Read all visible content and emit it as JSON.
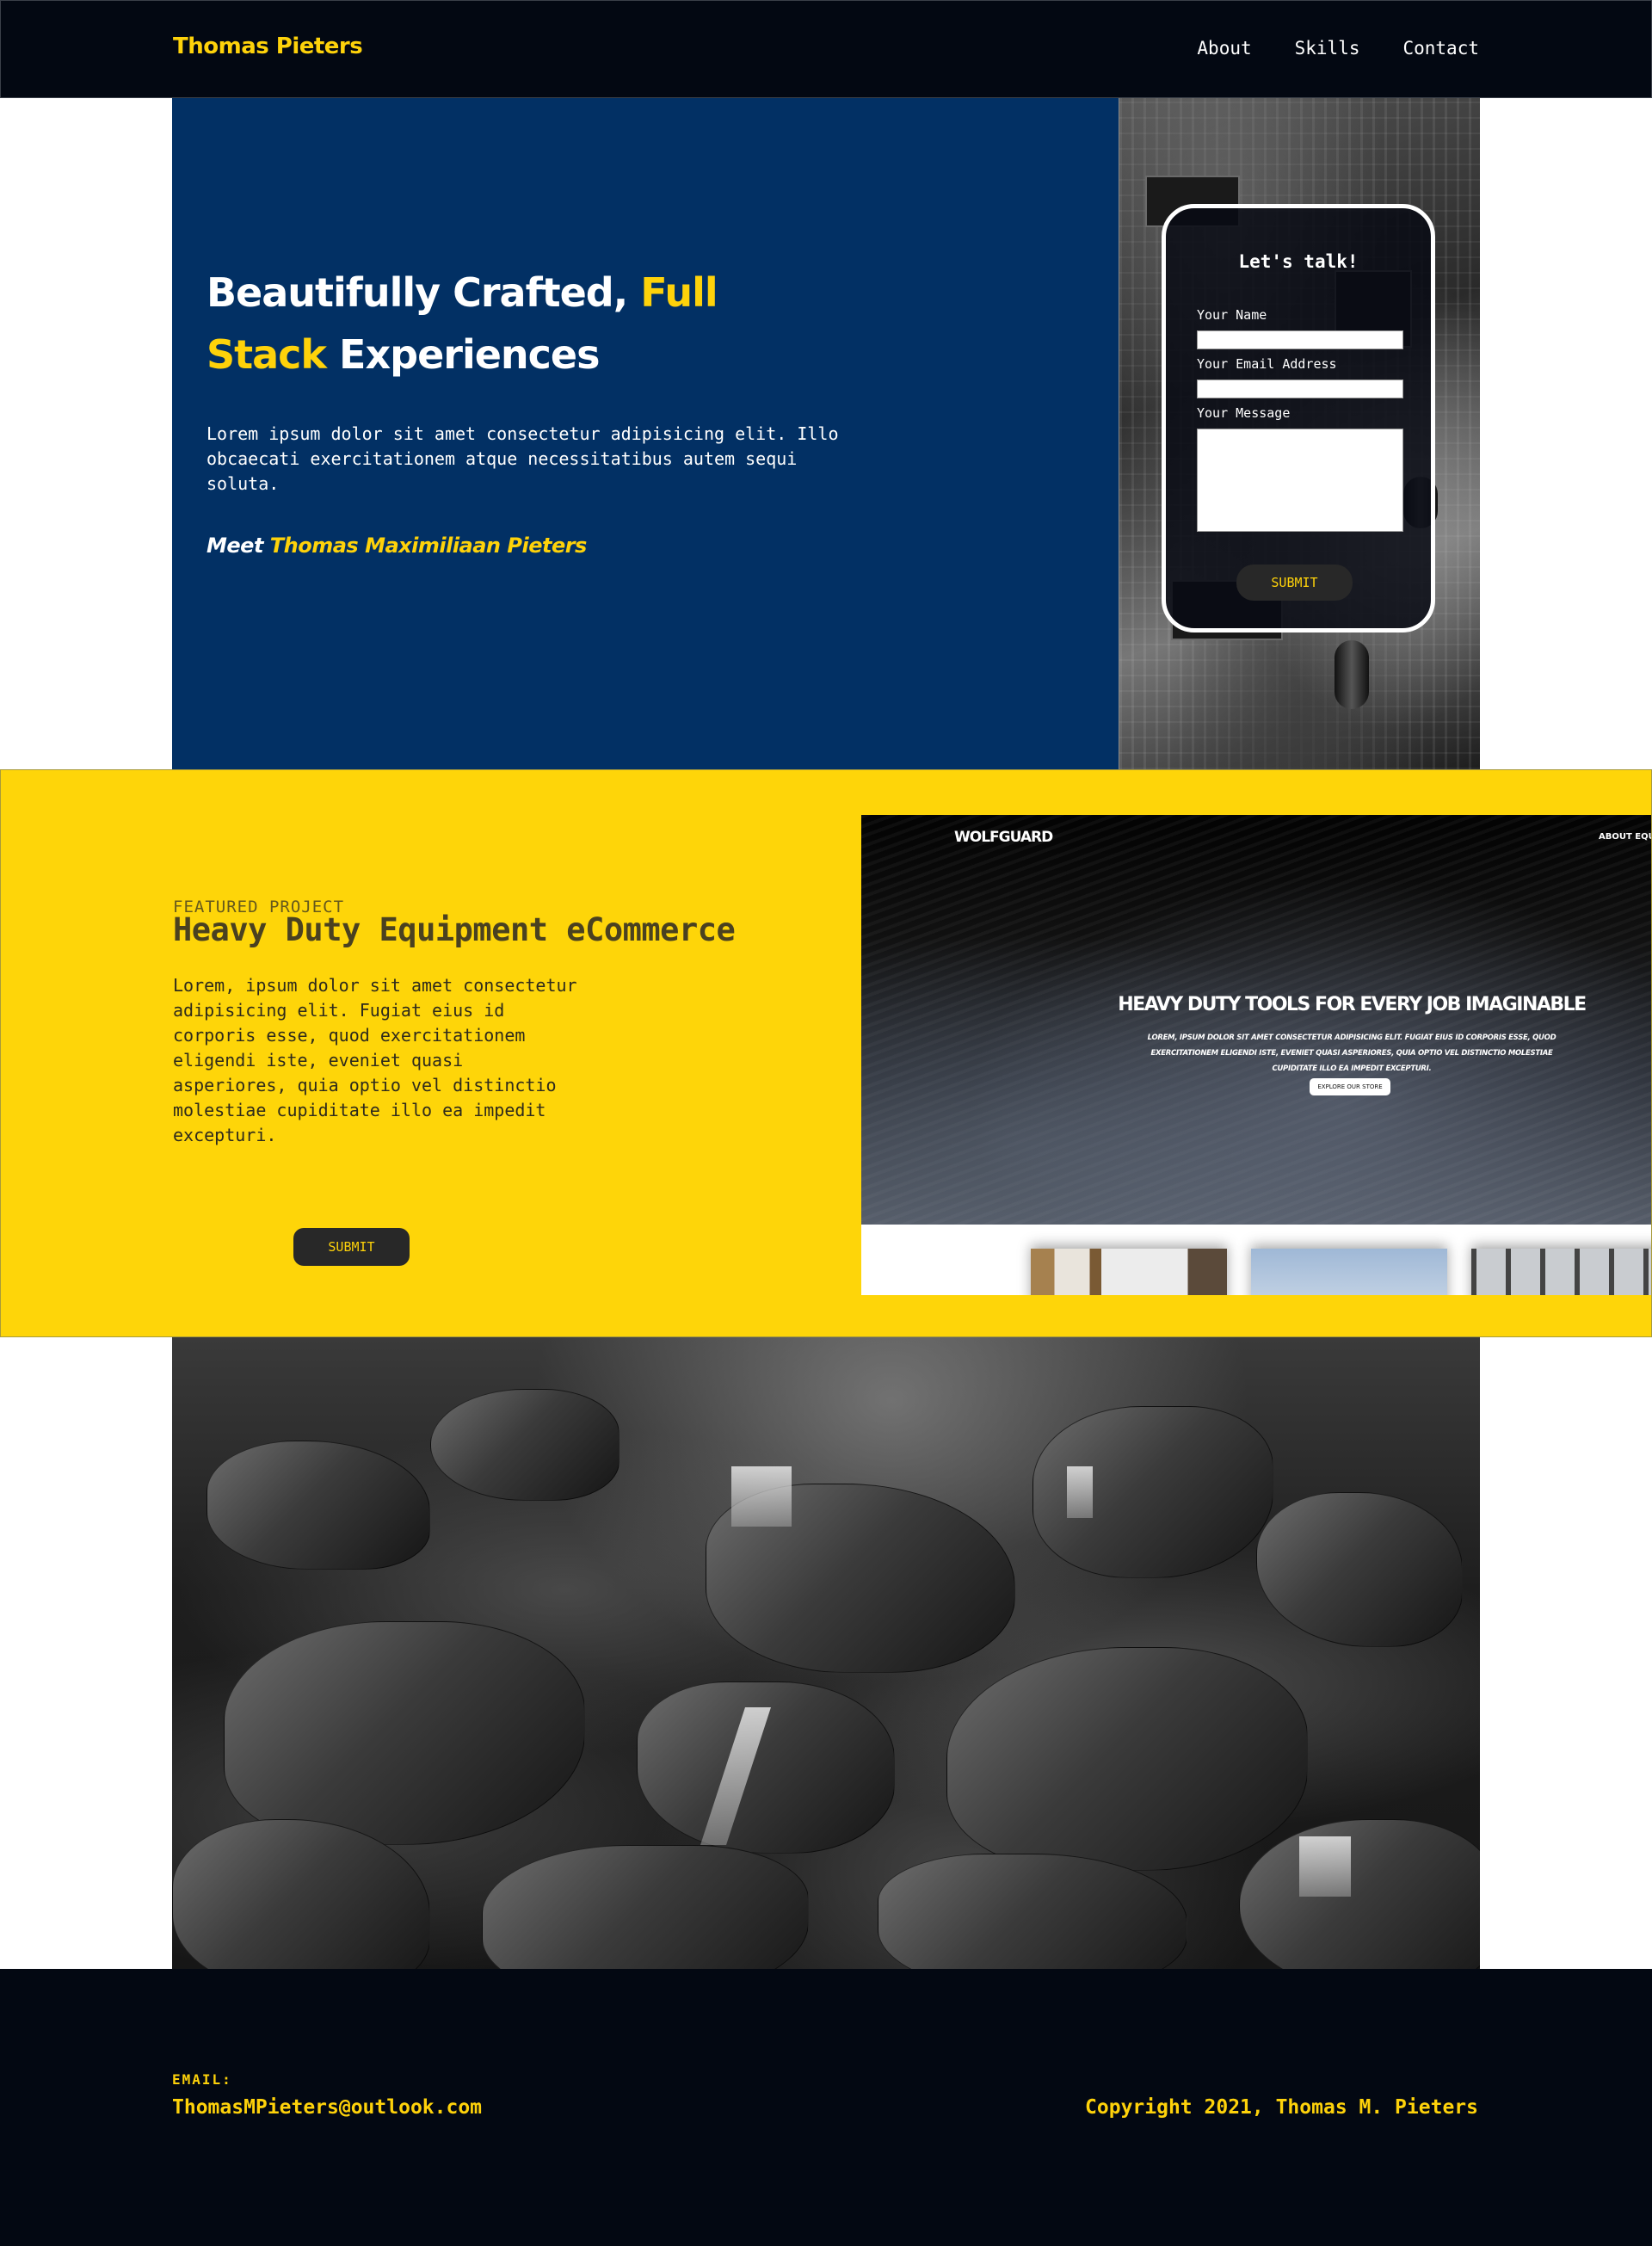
{
  "nav": {
    "brand": "Thomas Pieters",
    "links": [
      "About",
      "Skills",
      "Contact"
    ]
  },
  "hero": {
    "title_part1": "Beautifully Crafted,",
    "title_highlight1": "Full",
    "title_highlight2": "Stack",
    "title_part2": "Experiences",
    "text": "Lorem ipsum dolor sit amet consectetur adipisicing elit. Illo obcaecati exercitationem atque necessitatibus autem sequi soluta.",
    "meet_prefix": "Meet",
    "meet_name": "Thomas Maximiliaan Pieters"
  },
  "contact": {
    "title": "Let's talk!",
    "name_label": "Your Name",
    "name_value": "",
    "email_label": "Your Email Address",
    "email_value": "",
    "message_label": "Your Message",
    "message_value": "",
    "submit": "SUBMIT"
  },
  "featured": {
    "kicker": "FEATURED PROJECT",
    "title": "Heavy Duty Equipment eCommerce",
    "text": "Lorem, ipsum dolor sit amet consectetur adipisicing elit. Fugiat eius id corporis esse, quod exercitationem eligendi iste, eveniet quasi asperiores, quia optio vel distinctio molestiae cupiditate illo ea impedit excepturi.",
    "button": "SUBMIT",
    "preview": {
      "logo": "WOLFGUARD",
      "nav": "ABOUT   EQUIP",
      "headline": "HEAVY DUTY TOOLS FOR EVERY JOB IMAGINABLE",
      "sub": "LOREM, IPSUM DOLOR SIT AMET CONSECTETUR ADIPISICING ELIT. FUGIAT EIUS ID CORPORIS ESSE, QUOD EXERCITATIONEM ELIGENDI ISTE, EVENIET QUASI ASPERIORES, QUIA OPTIO VEL DISTINCTIO MOLESTIAE CUPIDITATE ILLO EA IMPEDIT EXCEPTURI.",
      "button": "EXPLORE OUR STORE"
    }
  },
  "footer": {
    "email_label": "EMAIL:",
    "email": "ThomasMPieters@outlook.com",
    "copyright": "Copyright 2021, Thomas M. Pieters"
  },
  "colors": {
    "navy": "#023064",
    "yellow": "#fed20a",
    "dark": "#030812"
  }
}
